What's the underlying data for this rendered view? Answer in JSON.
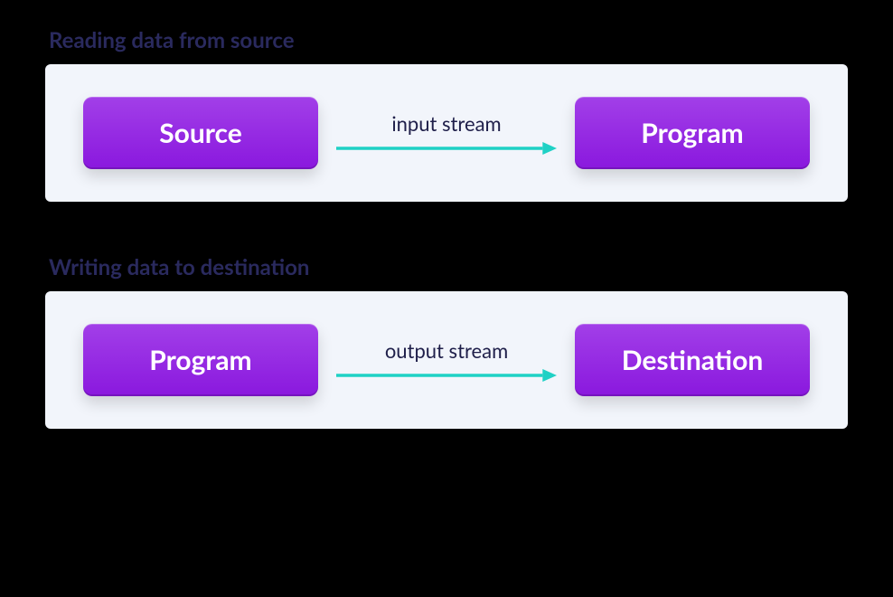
{
  "colors": {
    "background": "#000000",
    "panel": "#f2f5fb",
    "title": "#2a2a5e",
    "nodeGradientStart": "#a23fe8",
    "nodeGradientEnd": "#8a18de",
    "nodeText": "#ffffff",
    "arrow": "#1fd1c5",
    "arrowLabel": "#1f1f4a"
  },
  "diagrams": [
    {
      "title": "Reading data from source",
      "from": "Source",
      "to": "Program",
      "edgeLabel": "input stream"
    },
    {
      "title": "Writing data to destination",
      "from": "Program",
      "to": "Destination",
      "edgeLabel": "output stream"
    }
  ]
}
